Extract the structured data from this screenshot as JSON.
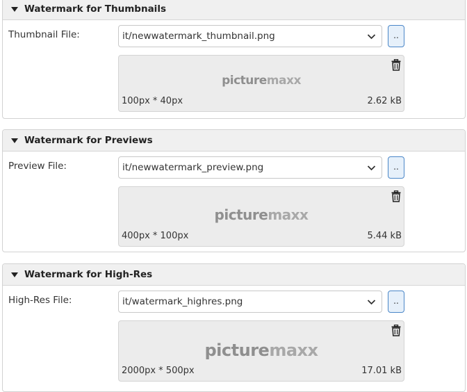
{
  "sections": [
    {
      "title": "Watermark for Thumbnails",
      "field_label": "Thumbnail File:",
      "file_value": "it/newwatermark_thumbnail.png",
      "browse_label": "..",
      "logo_part1": "picture",
      "logo_part2": "maxx",
      "dimensions": "100px * 40px",
      "file_size": "2.62 kB"
    },
    {
      "title": "Watermark for Previews",
      "field_label": "Preview File:",
      "file_value": "it/newwatermark_preview.png",
      "browse_label": "..",
      "logo_part1": "picture",
      "logo_part2": "maxx",
      "dimensions": "400px * 100px",
      "file_size": "5.44 kB"
    },
    {
      "title": "Watermark for High-Res",
      "field_label": "High-Res File:",
      "file_value": "it/watermark_highres.png",
      "browse_label": "..",
      "logo_part1": "picture",
      "logo_part2": "maxx",
      "dimensions": "2000px * 500px",
      "file_size": "17.01 kB"
    }
  ],
  "icons": {
    "collapse": "caret-down-icon",
    "dropdown": "chevron-down-icon",
    "delete": "trash-icon"
  },
  "colors": {
    "header_bg": "#f0f0f0",
    "browse_border": "#4a86c8",
    "browse_bg": "#e6f0fa",
    "preview_bg": "#ececec"
  }
}
